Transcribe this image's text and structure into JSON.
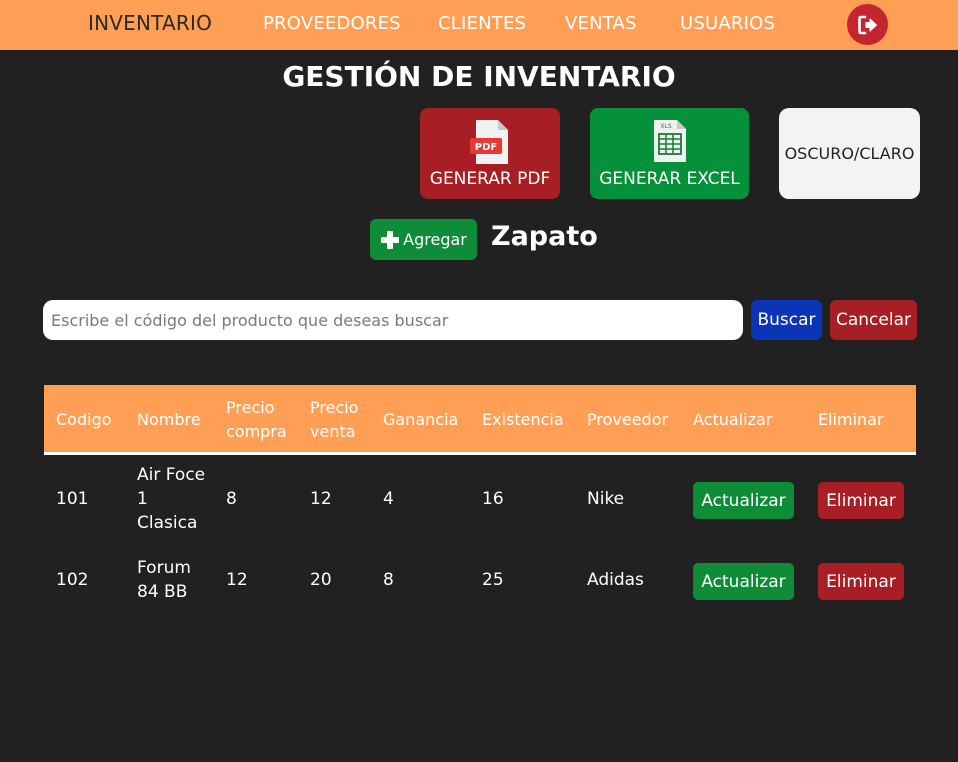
{
  "nav": {
    "items": [
      "INVENTARIO",
      "PROVEEDORES",
      "CLIENTES",
      "VENTAS",
      "USUARIOS"
    ],
    "active": "INVENTARIO",
    "logout_icon": "sign-out-icon"
  },
  "page": {
    "title": "GESTIÓN DE INVENTARIO"
  },
  "reports": {
    "pdf_label": "GENERAR PDF",
    "pdf_badge": "PDF",
    "excel_label": "GENERAR EXCEL",
    "excel_badge": "XLS",
    "theme_label": "OSCURO/CLARO"
  },
  "add": {
    "label": "Agregar",
    "category": "Zapato"
  },
  "search": {
    "placeholder": "Escribe el código del producto que deseas buscar",
    "value": "",
    "search_label": "Buscar",
    "cancel_label": "Cancelar"
  },
  "table": {
    "headers": [
      "Codigo",
      "Nombre",
      "Precio compra",
      "Precio venta",
      "Ganancia",
      "Existencia",
      "Proveedor",
      "Actualizar",
      "Eliminar"
    ],
    "rows": [
      {
        "codigo": "101",
        "nombre": "Air Foce 1 Clasica",
        "precio_compra": "8",
        "precio_venta": "12",
        "ganancia": "4",
        "existencia": "16",
        "proveedor": "Nike",
        "update_label": "Actualizar",
        "delete_label": "Eliminar"
      },
      {
        "codigo": "102",
        "nombre": "Forum 84 BB",
        "precio_compra": "12",
        "precio_venta": "20",
        "ganancia": "8",
        "existencia": "25",
        "proveedor": "Adidas",
        "update_label": "Actualizar",
        "delete_label": "Eliminar"
      }
    ]
  },
  "colors": {
    "navbar": "#ff9f55",
    "background": "#212121",
    "danger": "#a71f24",
    "success": "#0f8c37",
    "primary": "#0b35b6",
    "logout": "#c3262e"
  }
}
